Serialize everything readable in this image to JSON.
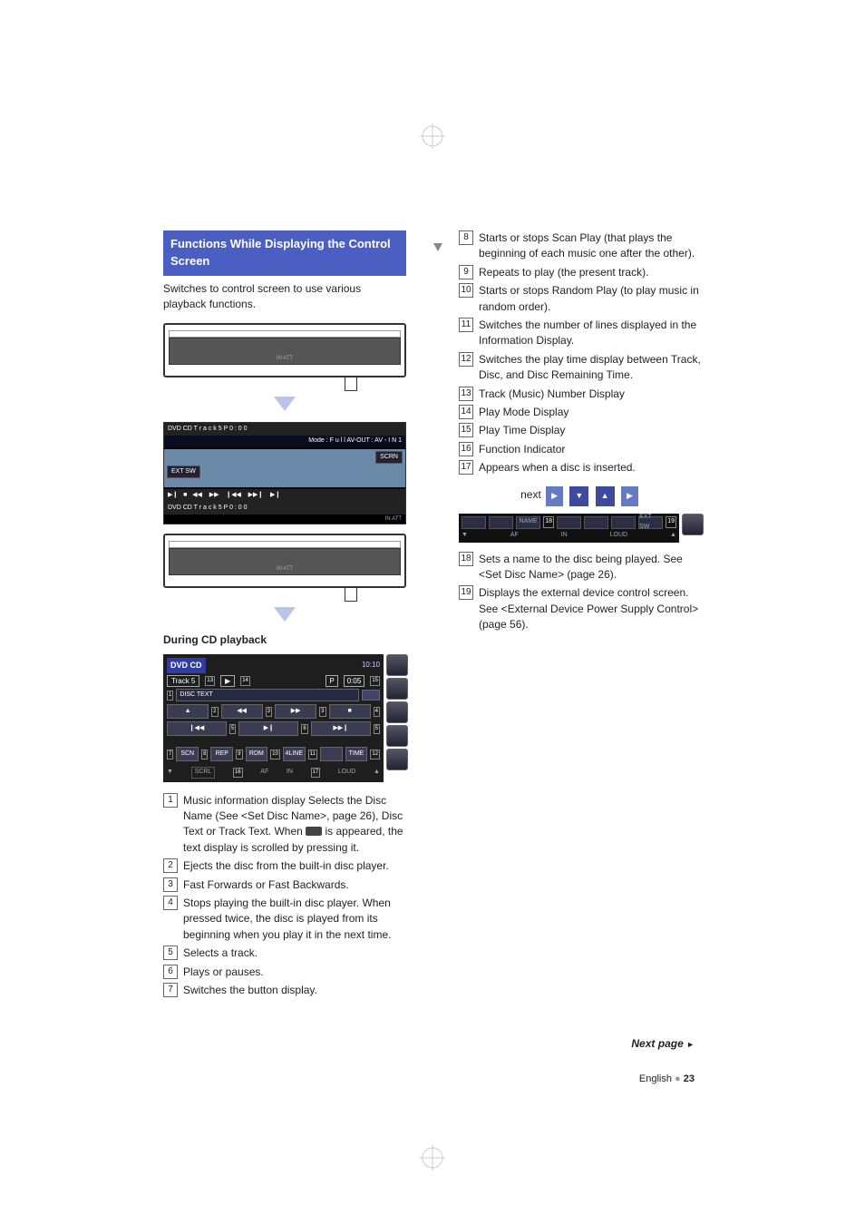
{
  "header": {
    "title_line1": "Functions While Displaying the Control",
    "title_line2": "Screen"
  },
  "intro": "Switches to control screen to use various playback functions.",
  "thin_bar_icons": "IN  ATT",
  "control_screen": {
    "top": "DVD  CD     T r a c k   5                                            P    0 : 0 0",
    "mode": "Mode :  F u l l             AV-OUT : AV - I N 1",
    "scrn": "SCRN",
    "extsw": "EXT SW",
    "bottom": "DVD  CD     T r a c k   5                                            P    0 : 0 0",
    "bottom_right": "IN     ATT"
  },
  "sub_heading": "During CD playback",
  "playback": {
    "header": "DVD CD",
    "track": "Track 5",
    "p": "P",
    "time": "0:05",
    "clock": "10:10",
    "disctext": "DISC TEXT",
    "buttons_row3": [
      "SCN",
      "REP",
      "RDM",
      "4LINE",
      "",
      "TIME"
    ],
    "scrl": "SCRL",
    "af": "AF",
    "in": "IN",
    "loud": "LOUD"
  },
  "left_items": [
    {
      "n": "1",
      "text": "Music information display\nSelects the Disc Name (See <Set Disc Name>, page 26), Disc Text or Track Text. When [scroll] is appeared, the text display is scrolled by pressing it."
    },
    {
      "n": "2",
      "text": "Ejects the disc from the built-in disc player."
    },
    {
      "n": "3",
      "text": "Fast Forwards or Fast Backwards."
    },
    {
      "n": "4",
      "text": "Stops playing the built-in disc player. When pressed twice, the disc is played from its beginning when you play it in the next time."
    },
    {
      "n": "5",
      "text": "Selects a track."
    },
    {
      "n": "6",
      "text": "Plays or pauses."
    },
    {
      "n": "7",
      "text": "Switches the button display."
    }
  ],
  "right_items_top": [
    {
      "n": "8",
      "text": "Starts or stops Scan Play (that plays the beginning of each music one after the other)."
    },
    {
      "n": "9",
      "text": "Repeats to play (the present track)."
    },
    {
      "n": "10",
      "text": "Starts or stops Random Play (to play music in random order)."
    },
    {
      "n": "11",
      "text": "Switches the number of lines displayed in the Information Display."
    },
    {
      "n": "12",
      "text": "Switches the play time display between Track, Disc, and Disc Remaining Time."
    },
    {
      "n": "13",
      "text": "Track (Music) Number Display"
    },
    {
      "n": "14",
      "text": "Play Mode Display"
    },
    {
      "n": "15",
      "text": "Play Time Display"
    },
    {
      "n": "16",
      "text": "Function Indicator"
    },
    {
      "n": "17",
      "text": "Appears when a disc is inserted."
    }
  ],
  "blue_buttons": [
    "▶",
    "▼",
    "▲",
    "▶"
  ],
  "dark_screen": {
    "name": "NAME",
    "extsw": "EXT SW",
    "n18": "18",
    "n19": "19",
    "af": "AF",
    "in": "IN",
    "loud": "LOUD"
  },
  "right_items_bottom": [
    {
      "n": "18",
      "text": "Sets a name to the disc being played. See <Set Disc Name> (page 26)."
    },
    {
      "n": "19",
      "text": "Displays the external device control screen. See <External Device Power Supply Control> (page 56)."
    }
  ],
  "next_page": "Next page ",
  "next_arrow": "►",
  "footer_lang": "English",
  "footer_page": "23",
  "callout_nums": {
    "n13": "13",
    "n14": "14",
    "n15": "15",
    "n1": "1",
    "n2": "2",
    "n3": "3",
    "n4": "4",
    "n5": "5",
    "n6": "6",
    "n7": "7",
    "n8": "8",
    "n9": "9",
    "n10": "10",
    "n11": "11",
    "n12": "12",
    "n16": "16",
    "n17": "17"
  }
}
